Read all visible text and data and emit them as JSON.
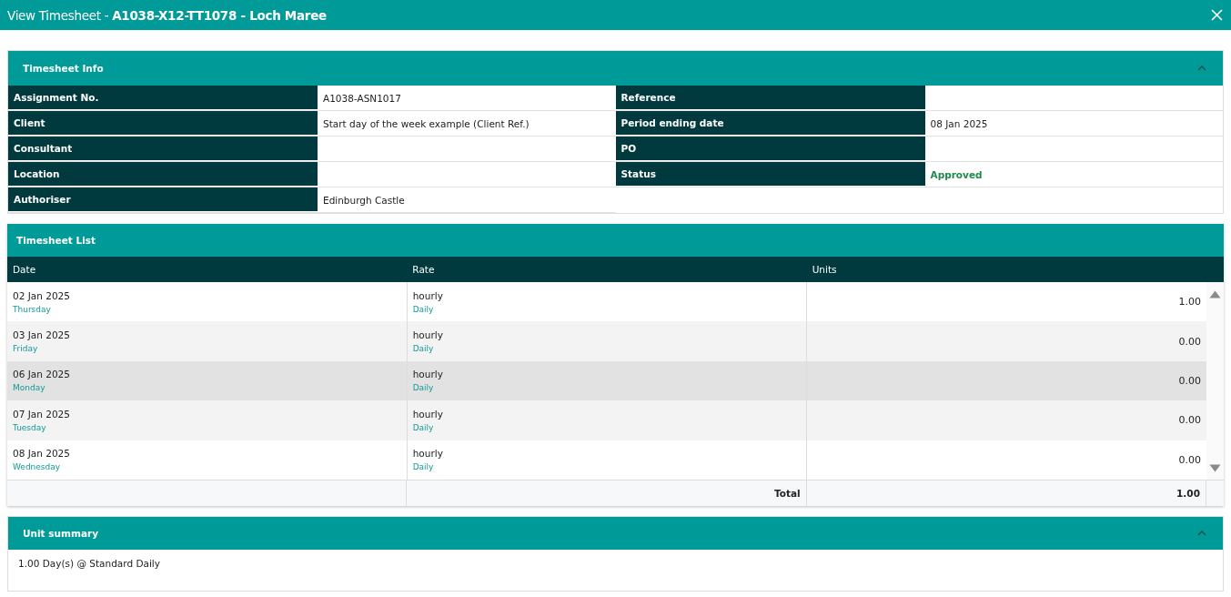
{
  "window": {
    "title": "View Timesheet - **A1038-X12-TT1078 - Loch Maree**"
  },
  "info": {
    "title": "Timesheet Info",
    "expanded": true,
    "left": [
      {
        "label": "Assignment No.",
        "value": "A1038-ASN1017",
        "kind": "text"
      },
      {
        "label": "Client",
        "value": "Start day of the week example (Client Ref.)",
        "kind": "text"
      },
      {
        "label": "Consultant"
      },
      {
        "label": "Location"
      },
      {
        "label": "Authoriser",
        "value": "Edinburgh Castle",
        "kind": "text"
      }
    ],
    "right": [
      {
        "label": "Reference"
      },
      {
        "label": "Period ending date",
        "value": "08 Jan 2025",
        "kind": "text"
      },
      {
        "label": "PO"
      },
      {
        "label": "Status",
        "value": "Approved",
        "kind": "status"
      }
    ]
  },
  "list": {
    "title": "Timesheet List",
    "columns": [
      "Date",
      "Rate",
      "Units"
    ],
    "rows": [
      {
        "date": "02 Jan 2025",
        "day": "Thursday",
        "rate": "hourly",
        "rate_type": "Daily",
        "units": "1.00",
        "selected": false
      },
      {
        "date": "03 Jan 2025",
        "day": "Friday",
        "rate": "hourly",
        "rate_type": "Daily",
        "units": "0.00",
        "selected": false
      },
      {
        "date": "06 Jan 2025",
        "day": "Monday",
        "rate": "hourly",
        "rate_type": "Daily",
        "units": "0.00",
        "selected": true
      },
      {
        "date": "07 Jan 2025",
        "day": "Tuesday",
        "rate": "hourly",
        "rate_type": "Daily",
        "units": "0.00",
        "selected": false
      },
      {
        "date": "08 Jan 2025",
        "day": "Wednesday",
        "rate": "hourly",
        "rate_type": "Daily",
        "units": "0.00",
        "selected": false
      }
    ],
    "total_label": "Total",
    "total": "1.00"
  },
  "summary": {
    "title": "Unit summary",
    "expanded": true,
    "text": "1.00 Day(s) @ Standard Daily"
  }
}
